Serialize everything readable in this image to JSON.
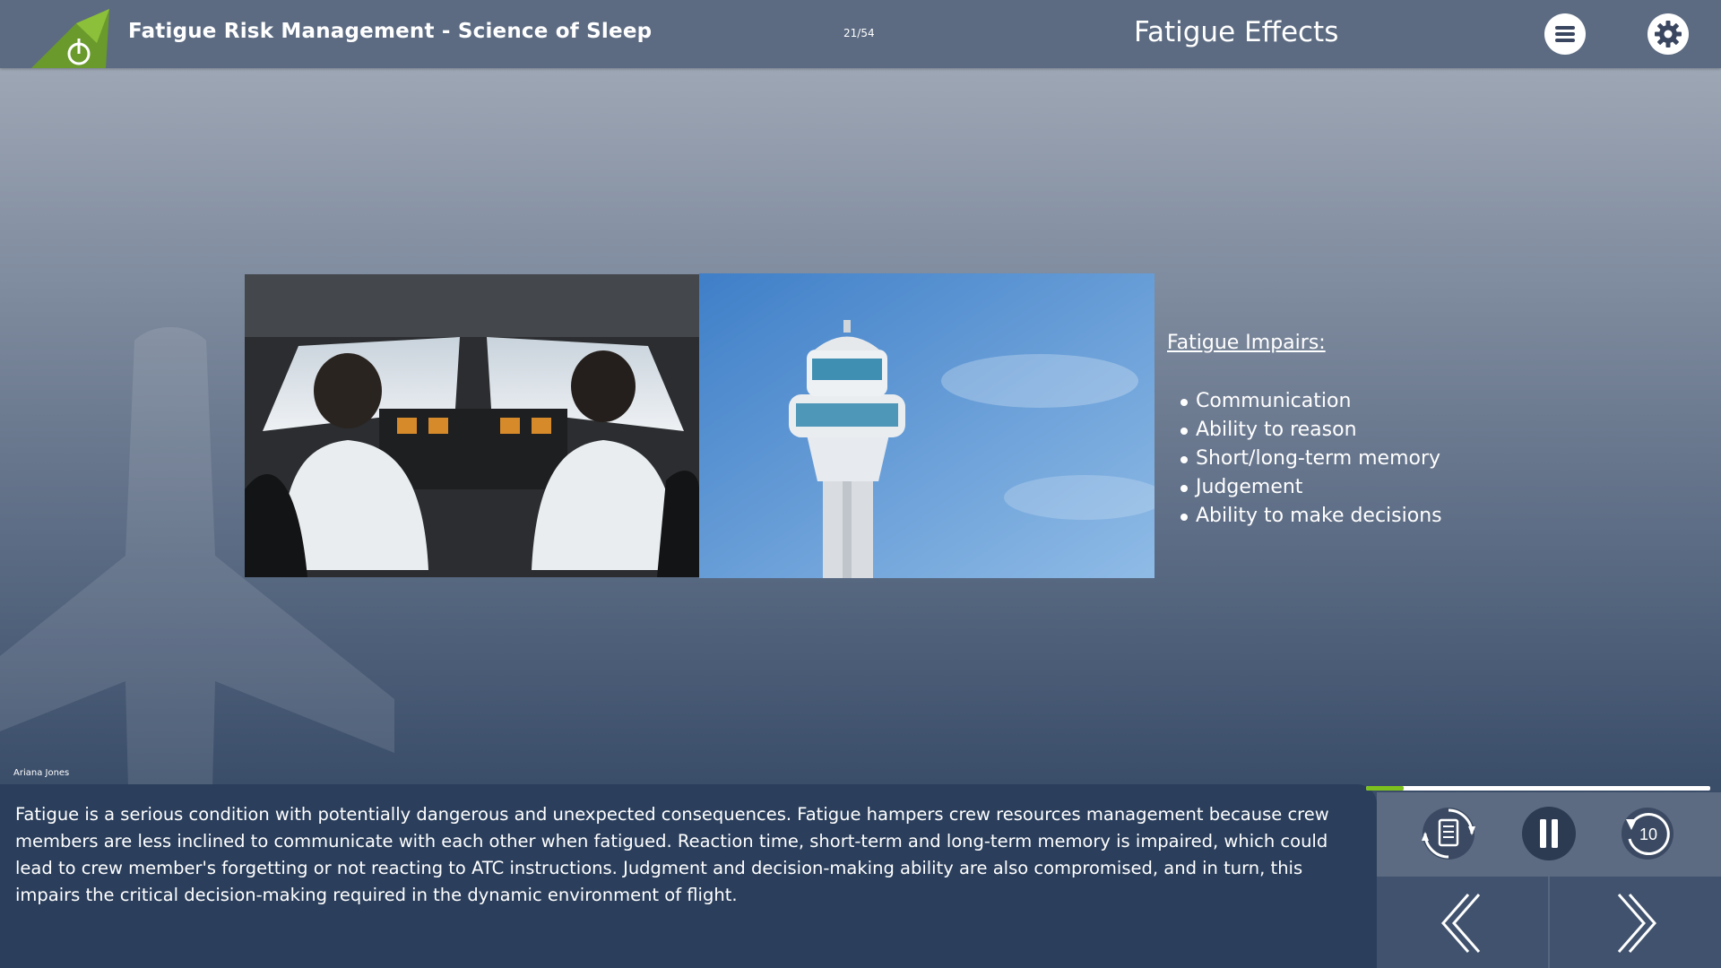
{
  "header": {
    "course_title": "Fatigue Risk Management - Science of Sleep",
    "page_counter": "21/54",
    "slide_title": "Fatigue Effects",
    "menu_icon": "hamburger-menu-icon",
    "settings_icon": "gear-icon",
    "logo": "aircraft-tail-logo"
  },
  "content": {
    "images": [
      "cockpit-pilots-photo",
      "control-tower-photo"
    ],
    "impairs_heading": "Fatigue Impairs:",
    "impairs_items": [
      "Communication",
      "Ability to reason",
      "Short/long-term memory",
      "Judgement",
      "Ability to make decisions"
    ]
  },
  "narrator": "Ariana Jones",
  "transcript": "Fatigue is a serious condition with potentially dangerous and unexpected consequences. Fatigue hampers crew resources management because crew members are less inclined to communicate with each other when fatigued. Reaction time, short-term and long-term memory is impaired, which could lead to crew member's forgetting or not reacting to ATC instructions. Judgment and decision-making ability are also compromised, and in turn, this impairs the critical decision-making required in the dynamic environment of flight.",
  "player": {
    "progress": 0.11,
    "transcript_icon": "transcript-toggle-icon",
    "pause_icon": "pause-icon",
    "replay_icon": "replay-10-icon",
    "replay_seconds": "10",
    "prev_icon": "chevron-left-icon",
    "next_icon": "chevron-right-icon"
  },
  "colors": {
    "header_bg": "#5c6b82",
    "transcript_bg": "#2b3f5c",
    "accent_green": "#7dc11e"
  }
}
